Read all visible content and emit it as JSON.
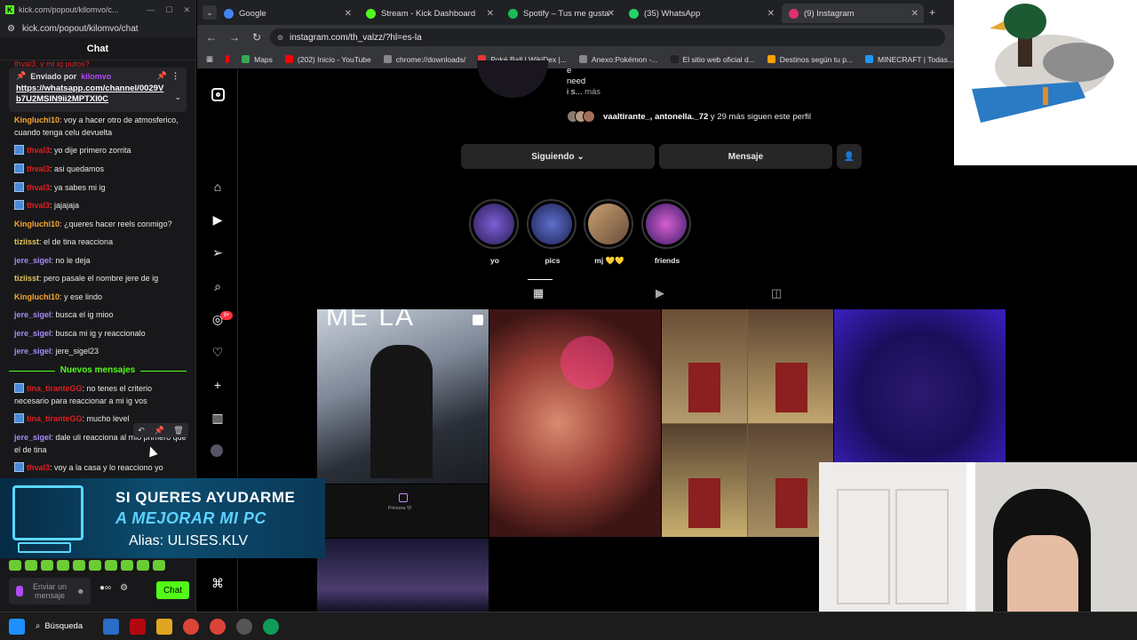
{
  "chat_window": {
    "title": "kick.com/popout/kilomvo/c...",
    "address": "kick.com/popout/kilomvo/chat",
    "header": "Chat",
    "pinned": {
      "label": "Enviado por",
      "username": "kilomvo",
      "link": "https://whatsapp.com/channel/0029Vb7U2MSIN9ii2MPTXI0C"
    },
    "partial_top_line": "thval3: y mi ig putos?",
    "messages": [
      {
        "user": "Kingluchi10",
        "text": ": voy a hacer otro de atmosferico, cuando tenga celu devuelta",
        "color": "#f8a52d",
        "badge": false
      },
      {
        "user": "thval3",
        "text": ": yo dije primero zorrita",
        "color": "#e02020",
        "badge": true
      },
      {
        "user": "thval3",
        "text": ": asi quedamos",
        "color": "#e02020",
        "badge": true
      },
      {
        "user": "thval3",
        "text": ": ya sabes mi ig",
        "color": "#e02020",
        "badge": true
      },
      {
        "user": "thval3",
        "text": ": jajajaja",
        "color": "#e02020",
        "badge": true
      },
      {
        "user": "Kingluchi10",
        "text": ": ¿queres hacer reels conmigo?",
        "color": "#f8a52d",
        "badge": false
      },
      {
        "user": "tiziisst",
        "text": ": el de tina reacciona",
        "color": "#e5c65b",
        "badge": false
      },
      {
        "user": "jere_sigel",
        "text": ": no le deja",
        "color": "#a68cf6",
        "badge": false
      },
      {
        "user": "tiziisst",
        "text": ": pero pasale el nombre jere de ig",
        "color": "#e5c65b",
        "badge": false
      },
      {
        "user": "Kingluchi10",
        "text": ": y ese lindo",
        "color": "#f8a52d",
        "badge": false
      },
      {
        "user": "jere_sigel",
        "text": ": busca el ig mioo",
        "color": "#a68cf6",
        "badge": false
      },
      {
        "user": "jere_sigel",
        "text": ": busca mi ig y reaccionalo",
        "color": "#a68cf6",
        "badge": false
      },
      {
        "user": "jere_sigel",
        "text": ": jere_sigel23",
        "color": "#a68cf6",
        "badge": false
      }
    ],
    "new_messages_label": "Nuevos mensajes",
    "new_messages": [
      {
        "user": "tina_tiranteGG",
        "text": ": no tenes el criterio necesario para reaccionar a mi ig vos",
        "color": "#e02020",
        "badge": true
      },
      {
        "user": "tina_tiranteGG",
        "text": ": mucho level",
        "color": "#e02020",
        "badge": true
      },
      {
        "user": "jere_sigel",
        "text": ": dale uli reacciona al mio primero que el de tina",
        "color": "#a68cf6",
        "badge": false
      },
      {
        "user": "thval3",
        "text": ": voy a la casa y lo reacciono yo",
        "color": "#e02020",
        "badge": true
      }
    ],
    "input_placeholder": "Enviar un mensaje",
    "send_label": "Chat",
    "brand_color": "#53fc18"
  },
  "banner": {
    "line1": "SI QUERES AYUDARME",
    "line2": "A MEJORAR MI PC",
    "line3": "Alias: ULISES.KLV"
  },
  "browser": {
    "tabs": [
      {
        "label": "Google",
        "color": "#4285f4",
        "active": false
      },
      {
        "label": "Stream - Kick Dashboard",
        "color": "#53fc18",
        "active": false
      },
      {
        "label": "Spotify – Tus me gusta",
        "color": "#1db954",
        "active": false
      },
      {
        "label": "(35) WhatsApp",
        "color": "#25d366",
        "active": false
      },
      {
        "label": "(9) Instagram",
        "color": "#e1306c",
        "active": true
      }
    ],
    "url": "instagram.com/th_valzz/?hl=es-la",
    "bookmarks": [
      "Maps",
      "(202) Inicio - YouTube",
      "chrome://downloads/",
      "Poké Ball | WikiDex |...",
      "Anexo:Pokémon -...",
      "El sitio web oficial d...",
      "Destinos según tu p...",
      "MINECRAFT | Todas..."
    ]
  },
  "instagram": {
    "bio": [
      "e",
      "need",
      "i s..."
    ],
    "more_label": "más",
    "followers_prefix": "vaaltirante_, antonella._72",
    "followers_suffix": " y 29 más siguen este perfil",
    "following_button": "Siguiendo",
    "message_button": "Mensaje",
    "highlights": [
      "yo",
      "pics",
      "mj 💛💛",
      "friends"
    ],
    "notification_count": "9+",
    "post_overlay_text": "ME LA",
    "post_caption": "Princesa 🖤"
  },
  "taskbar": {
    "search_label": "Búsqueda"
  }
}
